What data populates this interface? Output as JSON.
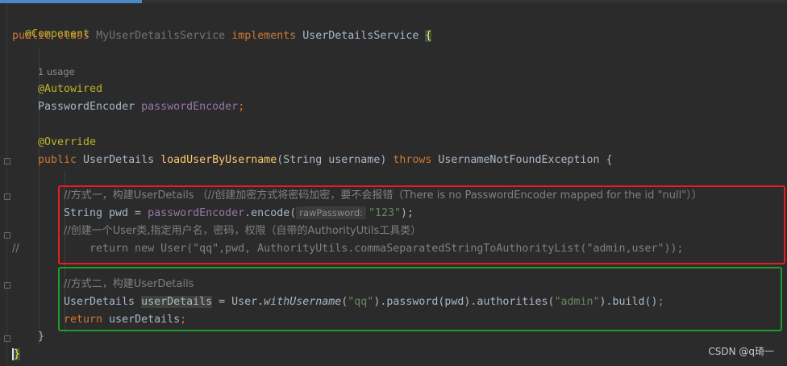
{
  "editor": {
    "usage_hint": "1 usage",
    "param_hint": "rawPassword:",
    "watermark": "CSDN @q琦一",
    "lines": {
      "l1": {
        "ann": "@Component"
      },
      "l2": {
        "kw1": "public class ",
        "name": "MyUserDetailsService",
        "kw2": " implements ",
        "iface": "UserDetailsService ",
        "brace": "{"
      },
      "l4": {
        "ann": "@Autowired"
      },
      "l5": {
        "type": "PasswordEncoder ",
        "field": "passwordEncoder",
        "semi": ";"
      },
      "l7": {
        "ann": "@Override"
      },
      "l8": {
        "kw": "public ",
        "type": "UserDetails ",
        "method": "loadUserByUsername",
        "params": "(String username) ",
        "throws": "throws ",
        "exc": "UsernameNotFoundException {"
      },
      "l10": {
        "comment": "//方式一，构建UserDetails （//创建加密方式将密码加密，要不会报错（There is no PasswordEncoder mapped for the id \"null\"））"
      },
      "l11": {
        "pre": "String pwd = ",
        "field": "passwordEncoder",
        "call": ".encode(",
        "str": "\"123\"",
        "end": ");"
      },
      "l12": {
        "comment": "//创建一个User类,指定用户名，密码，权限（自带的AuthorityUtils工具类）"
      },
      "l13": {
        "marker": "//",
        "code": "    return new User(\"qq\",pwd, AuthorityUtils.commaSeparatedStringToAuthorityList(\"admin,user\"));"
      },
      "l15": {
        "comment": "//方式二，构建UserDetails"
      },
      "l16": {
        "type": "UserDetails ",
        "var": "userDetails",
        "eq": " = User.",
        "m1": "withUsername",
        "p1": "(",
        "s1": "\"qq\"",
        "m2": ").password(pwd).authorities(",
        "s2": "\"admin\"",
        "m3": ").build()",
        "semi": ";"
      },
      "l17": {
        "kw": "return ",
        "var": "userDetails",
        "semi": ";"
      },
      "l18": {
        "brace": "}"
      },
      "l19": {
        "brace": "}"
      }
    }
  }
}
